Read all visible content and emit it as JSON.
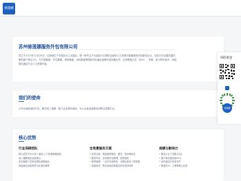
{
  "header": {
    "logo_text": "修莲娜"
  },
  "intro": {
    "company_name": "苏州修莲娜服务外包有限公司",
    "description": "成立于2023年12月26日，注册地位于中国苏州工业园区，是一家专注于为酒店行业提供全链条人力资源与配套服务的创新型企业。目前已在全国范围内服务客户超过1万，与万豪集团、华住集团、首旅集团、洲际集团等国际知名酒店品牌达成战略合作，业务覆盖江苏（苏州），安徽、浙江等多省市，持续推动酒店行业人力资源升级。"
  },
  "qr": {
    "title": "扫码关注",
    "mini_logo_text": "修莲娜"
  },
  "mission": {
    "title": "我们的使命",
    "text": "以专业赋能酒店行业，解决用工难题，助力企业降本增效，为从业者创造更优的职业发展平台。"
  },
  "advantages": {
    "title": "核心优势",
    "columns": [
      {
        "heading": "行业深耕团队",
        "lines": [
          "核心成员平均10年+酒店/人力资源管理经验",
          "深入理解酒店运营痛点，",
          "多名管理人员来自国际品牌酒店，",
          "深谙酒店运营需求与标准化管理"
        ]
      },
      {
        "heading": "全场景服务方案",
        "lines": [
          "• 劳务派遣：覆盖客房服务、餐饮、前台等岗位",
          "• 服务外包：全流程外包管理，提质增效",
          "• 薪资管理：一站式代发薪资、代缴社保及个税申报",
          "• 技能培训：联合各酒店集团定制化培训体系"
        ]
      },
      {
        "heading": "规模与影响力",
        "lines": [
          "• 服务从业人员超1万名",
          "• 客户满意度持续92%",
          "• 合作酒店分布多省市",
          "• 覆盖苏州、上海等核心区域"
        ]
      }
    ]
  }
}
